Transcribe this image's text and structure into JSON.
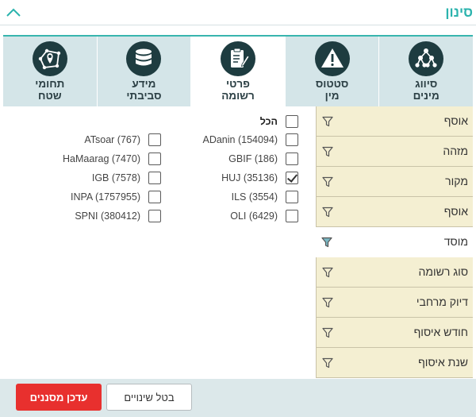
{
  "header": {
    "title": "סינון",
    "collapse_icon": "chevron-up-icon"
  },
  "colors": {
    "accent": "#2bb3ad",
    "tab_bg": "#d4e5e8",
    "icon_bg": "#1e3c40",
    "filter_bg": "#f4efd2",
    "apply": "#e8302e"
  },
  "tabs": [
    {
      "label": "סיווג\nמינים",
      "icon": "taxonomy-tree-icon",
      "active": false
    },
    {
      "label": "סטטוס\nמין",
      "icon": "warning-icon",
      "active": false
    },
    {
      "label": "פרטי\nרשומה",
      "icon": "clipboard-edit-icon",
      "active": true
    },
    {
      "label": "מידע\nסביבתי",
      "icon": "database-icon",
      "active": false
    },
    {
      "label": "תחומי\nשטח",
      "icon": "map-polygon-pin-icon",
      "active": false
    }
  ],
  "options": {
    "all_label": "הכל",
    "right_column": [
      {
        "label": "ADanin (154094)",
        "checked": false
      },
      {
        "label": "GBIF (186)",
        "checked": false
      },
      {
        "label": "HUJ (35136)",
        "checked": true
      },
      {
        "label": "ILS (3554)",
        "checked": false
      },
      {
        "label": "OLI (6429)",
        "checked": false
      }
    ],
    "left_column": [
      {
        "label": "ATsoar (767)",
        "checked": false
      },
      {
        "label": "HaMaarag (7470)",
        "checked": false
      },
      {
        "label": "IGB (7578)",
        "checked": false
      },
      {
        "label": "INPA (1757955)",
        "checked": false
      },
      {
        "label": "SPNI (380412)",
        "checked": false
      }
    ]
  },
  "filters": [
    {
      "label": "אוסף",
      "icon": "filter-icon",
      "style": "highlight"
    },
    {
      "label": "מזהה",
      "icon": "filter-icon",
      "style": "highlight"
    },
    {
      "label": "מקור",
      "icon": "filter-icon",
      "style": "highlight"
    },
    {
      "label": "אוסף",
      "icon": "filter-icon",
      "style": "highlight"
    },
    {
      "label": "מוסד",
      "icon": "filter-active-icon",
      "style": "plain"
    },
    {
      "label": "סוג רשומה",
      "icon": "filter-icon",
      "style": "highlight"
    },
    {
      "label": "דיוק מרחבי",
      "icon": "filter-icon",
      "style": "highlight"
    },
    {
      "label": "חודש איסוף",
      "icon": "filter-icon",
      "style": "highlight"
    },
    {
      "label": "שנת איסוף",
      "icon": "filter-icon",
      "style": "highlight"
    }
  ],
  "footer": {
    "cancel_label": "בטל שינויים",
    "apply_label": "עדכן מסננים"
  }
}
